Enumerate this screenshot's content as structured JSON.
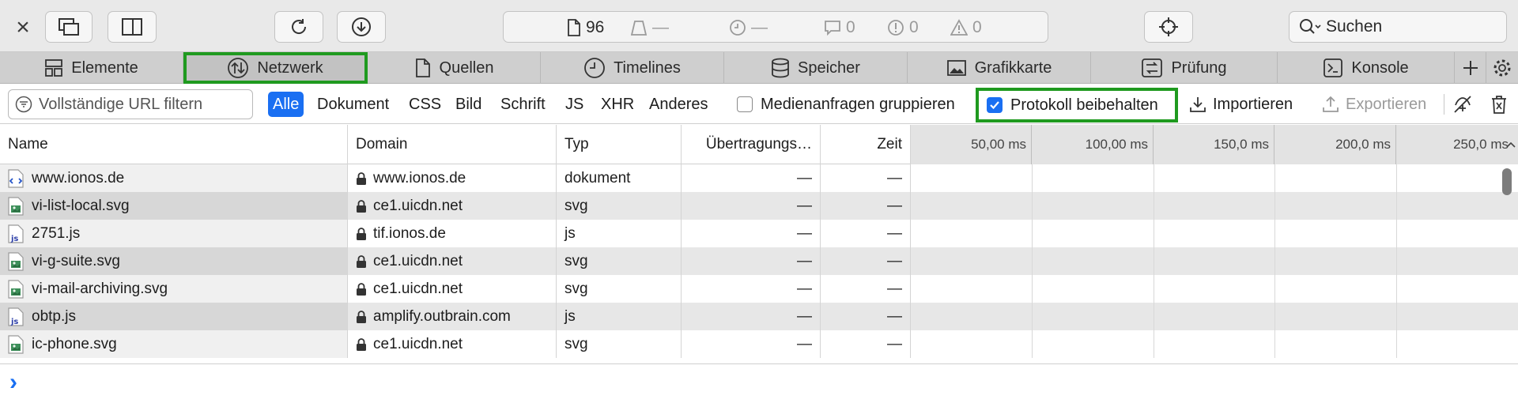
{
  "toolbar": {
    "close_label": "×",
    "resource_count": "96",
    "transferred": "—",
    "time": "—",
    "log_count": "0",
    "error_count": "0",
    "warning_count": "0",
    "search_label": "Suchen"
  },
  "tabs": [
    {
      "label": "Elemente",
      "icon": "layout-icon"
    },
    {
      "label": "Netzwerk",
      "icon": "network-icon"
    },
    {
      "label": "Quellen",
      "icon": "document-icon"
    },
    {
      "label": "Timelines",
      "icon": "clock-icon"
    },
    {
      "label": "Speicher",
      "icon": "database-icon"
    },
    {
      "label": "Grafikkarte",
      "icon": "image-icon"
    },
    {
      "label": "Prüfung",
      "icon": "audit-icon"
    },
    {
      "label": "Konsole",
      "icon": "console-icon"
    }
  ],
  "filter": {
    "placeholder": "Vollständige URL filtern",
    "types": [
      "Alle",
      "Dokument",
      "CSS",
      "Bild",
      "Schrift",
      "JS",
      "XHR",
      "Anderes"
    ],
    "group_media_label": "Medienanfragen gruppieren",
    "preserve_log_label": "Protokoll beibehalten",
    "import_label": "Importieren",
    "export_label": "Exportieren"
  },
  "table": {
    "columns": [
      "Name",
      "Domain",
      "Typ",
      "Übertragungs…",
      "Zeit"
    ],
    "timeline_ticks": [
      "50,00 ms",
      "100,00 ms",
      "150,0 ms",
      "200,0 ms",
      "250,0 ms"
    ],
    "rows": [
      {
        "name": "www.ionos.de",
        "domain": "www.ionos.de",
        "type": "dokument",
        "transfer": "—",
        "time": "—",
        "icon": "html-file-icon"
      },
      {
        "name": "vi-list-local.svg",
        "domain": "ce1.uicdn.net",
        "type": "svg",
        "transfer": "—",
        "time": "—",
        "icon": "image-file-icon"
      },
      {
        "name": "2751.js",
        "domain": "tif.ionos.de",
        "type": "js",
        "transfer": "—",
        "time": "—",
        "icon": "js-file-icon"
      },
      {
        "name": "vi-g-suite.svg",
        "domain": "ce1.uicdn.net",
        "type": "svg",
        "transfer": "—",
        "time": "—",
        "icon": "image-file-icon"
      },
      {
        "name": "vi-mail-archiving.svg",
        "domain": "ce1.uicdn.net",
        "type": "svg",
        "transfer": "—",
        "time": "—",
        "icon": "image-file-icon"
      },
      {
        "name": "obtp.js",
        "domain": "amplify.outbrain.com",
        "type": "js",
        "transfer": "—",
        "time": "—",
        "icon": "js-file-icon"
      },
      {
        "name": "ic-phone.svg",
        "domain": "ce1.uicdn.net",
        "type": "svg",
        "transfer": "—",
        "time": "—",
        "icon": "image-file-icon"
      }
    ]
  },
  "console": {
    "prompt": "›"
  },
  "colors": {
    "accent": "#1a6ff2",
    "highlight": "#1f9a1f"
  }
}
